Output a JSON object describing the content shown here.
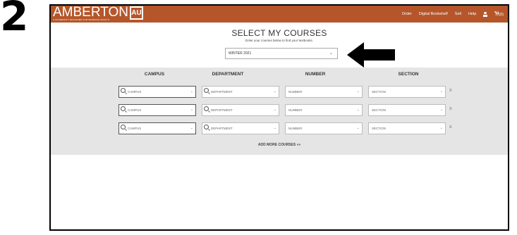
{
  "step": "2",
  "brand": {
    "name": "AMBERTON",
    "mark": "AU",
    "tagline": "A UNIVERSITY DESIGNED FOR WORKING ADULTS"
  },
  "nav": {
    "order": "Order",
    "bookshelf": "Digital Bookshelf",
    "sell": "Sell",
    "help": "Help",
    "cart": "(0)"
  },
  "page": {
    "title": "SELECT MY COURSES",
    "subtitle": "Enter your courses below to find your textbooks."
  },
  "term": {
    "selected": "WINTER 2021"
  },
  "columns": {
    "campus": "CAMPUS",
    "department": "DEPARTMENT",
    "number": "NUMBER",
    "section": "SECTION"
  },
  "rows": [
    {
      "campus": "CAMPUS",
      "department": "DEPARTMENT",
      "number": "NUMBER",
      "section": "SECTION",
      "remove": "X"
    },
    {
      "campus": "CAMPUS",
      "department": "DEPARTMENT",
      "number": "NUMBER",
      "section": "SECTION",
      "remove": "X"
    },
    {
      "campus": "CAMPUS",
      "department": "DEPARTMENT",
      "number": "NUMBER",
      "section": "SECTION",
      "remove": "X"
    }
  ],
  "add_more": "ADD MORE COURSES »»",
  "colors": {
    "header": "#b5562a",
    "panel": "#e5e5e5"
  }
}
